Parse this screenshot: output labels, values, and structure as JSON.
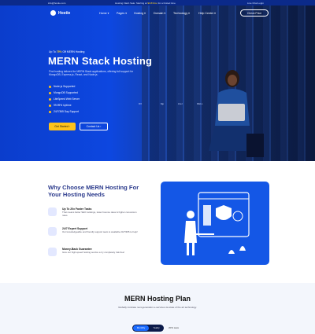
{
  "topbar": {
    "email": "info@hostie.com",
    "promo": "Hosting Flash Sale: Starting at",
    "promo_highlight": "$0.83/mo",
    "promo_tail": "for a limited time",
    "live_chat": "Live Chat",
    "login": "Login"
  },
  "nav": {
    "logo": "Hostie",
    "items": [
      "Home ▾",
      "Pages ▾",
      "Hosting ▾",
      "Domain ▾",
      "Technology ▾",
      "Help Center ▾"
    ],
    "check_button": "Check Price"
  },
  "hero": {
    "badge": "Up To",
    "badge_highlight": "75%",
    "badge_tail": "Off MERN Hosting",
    "title": "MERN Stack Hosting",
    "description": "Find hosting tailored for MERN Stack applications, offering full support for MongoDB, Express.js, React, and Node.js.",
    "features": [
      "Node.js Supported",
      "MongoDB Supported",
      "LiteSpeed Web Server",
      "99.99% Uptime",
      "24/7/365 Day Support"
    ],
    "get_started": "Get Started ›",
    "contact_us": "Contact Us ›",
    "brands": [
      "DX",
      "",
      "hp",
      "",
      "intel",
      "",
      "DELL",
      ""
    ],
    "colors": {
      "accent": "#ffc21a",
      "primary": "#0d47e0"
    }
  },
  "why": {
    "heading": "Why Choose MERN Hosting For Your Hosting Needs",
    "items": [
      {
        "title": "Up To 20x Faster Tasks",
        "desc": "That means better SEO rankings, lower bounce rates & higher conversion rates."
      },
      {
        "title": "24/7 Expert Support",
        "desc": "Our knowledgeable and friendly support team is available 24/7/365 to help!"
      },
      {
        "title": "Money-Back Guarantee",
        "desc": "Give our high-speed hosting service a try completely risk-free!"
      }
    ]
  },
  "plan": {
    "heading": "MERN Hosting Plan",
    "description": "Globally incubate next-generation e-services via state of the art technology.",
    "toggle_monthly": "Monthly",
    "toggle_yearly": "Yearly",
    "save_label": "20% save"
  }
}
